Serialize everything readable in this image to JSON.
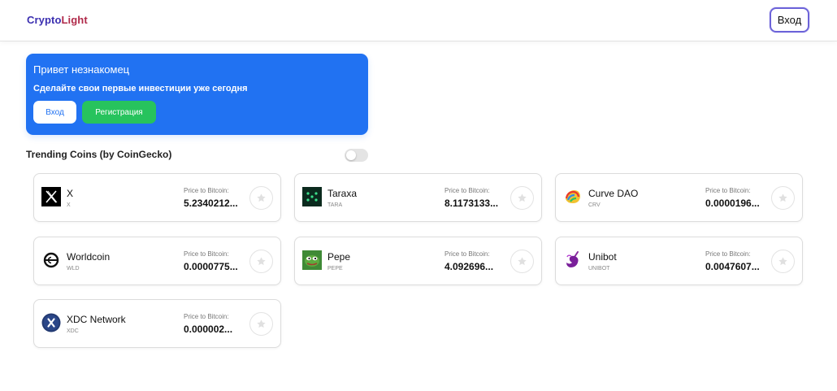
{
  "header": {
    "logo_part1": "Crypto",
    "logo_part2": "Light",
    "login_label": "Вход"
  },
  "promo": {
    "title": "Привет незнакомец",
    "subtitle": "Сделайте свои первые инвестиции уже сегодня",
    "login_label": "Вход",
    "register_label": "Регистрация",
    "bg_color": "#2172f2",
    "register_color": "#27c35d"
  },
  "trending": {
    "title": "Trending Coins (by CoinGecko)",
    "toggle_on": false,
    "price_label": "Price to Bitcoin:",
    "coins": [
      {
        "name": "X",
        "symbol": "X",
        "price": "5.2340212...",
        "icon": "x-coin-icon"
      },
      {
        "name": "Taraxa",
        "symbol": "TARA",
        "price": "8.1173133...",
        "icon": "taraxa-icon"
      },
      {
        "name": "Curve DAO",
        "symbol": "CRV",
        "price": "0.0000196...",
        "icon": "curve-dao-icon"
      },
      {
        "name": "Worldcoin",
        "symbol": "WLD",
        "price": "0.0000775...",
        "icon": "worldcoin-icon"
      },
      {
        "name": "Pepe",
        "symbol": "PEPE",
        "price": "4.092696...",
        "icon": "pepe-icon"
      },
      {
        "name": "Unibot",
        "symbol": "UNIBOT",
        "price": "0.0047607...",
        "icon": "unibot-icon"
      },
      {
        "name": "XDC Network",
        "symbol": "XDC",
        "price": "0.000002...",
        "icon": "xdc-network-icon"
      }
    ]
  }
}
